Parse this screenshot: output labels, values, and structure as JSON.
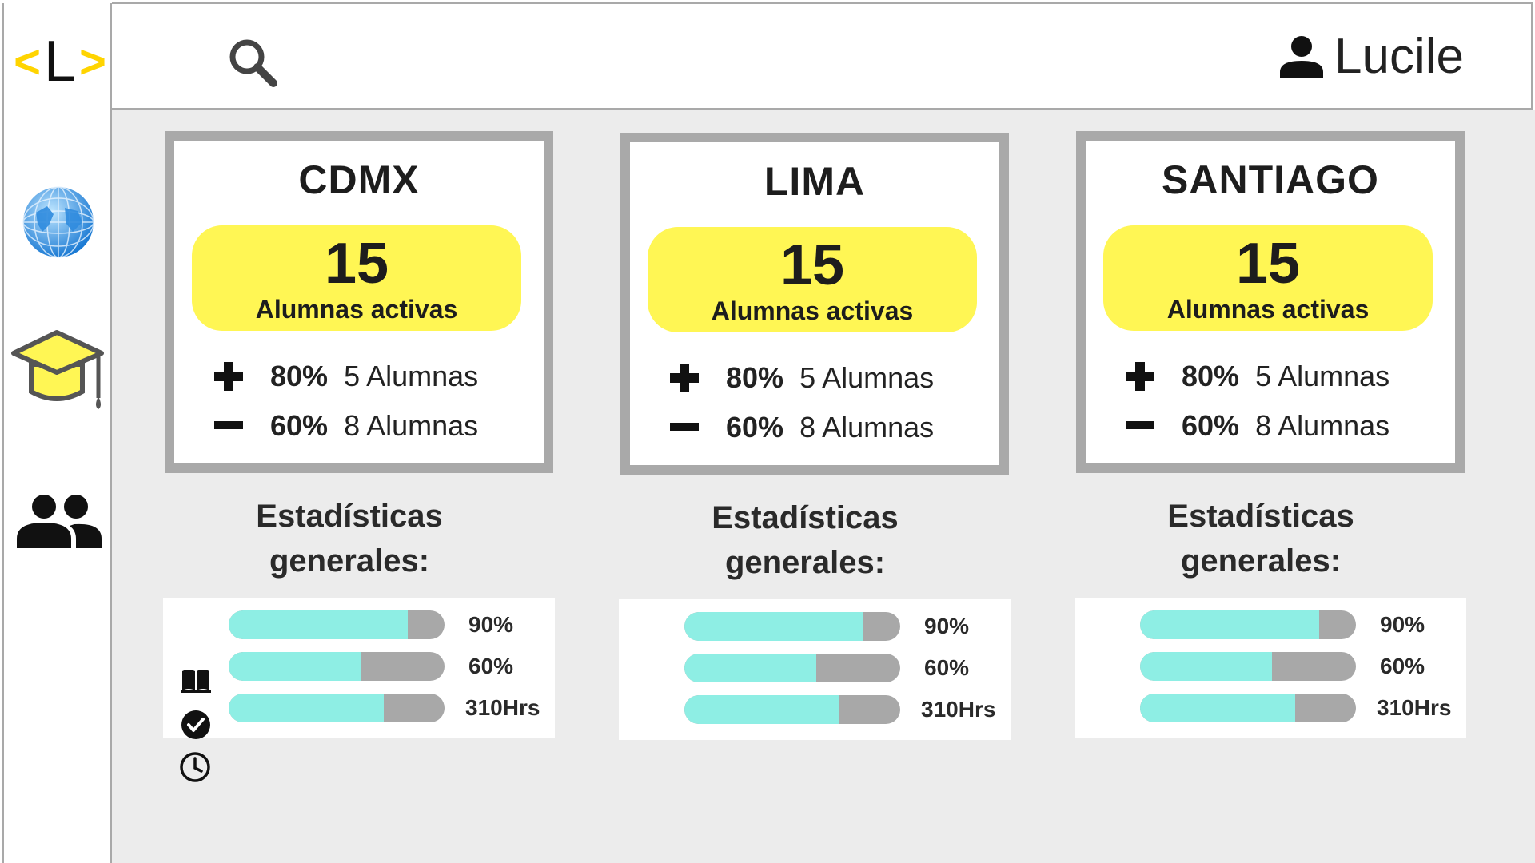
{
  "app": {
    "logo": {
      "left": "<",
      "letter": "L",
      "right": ">"
    },
    "user": {
      "name": "Lucile"
    }
  },
  "sidebar": {
    "items": [
      {
        "icon": "globe-icon"
      },
      {
        "icon": "graduation-cap-icon"
      },
      {
        "icon": "group-icon"
      }
    ]
  },
  "colors": {
    "accent": "#fff654",
    "bar_fill": "#8eeee4",
    "bar_track": "#a8a8a8",
    "border": "#a9a9a9",
    "background": "#ececec"
  },
  "stats_heading_line1": "Estadísticas",
  "stats_heading_line2": "generales:",
  "cities": [
    {
      "name": "CDMX",
      "count": "15",
      "count_label": "Alumnas activas",
      "plus_pct": "80%",
      "plus_text": "5 Alumnas",
      "minus_pct": "60%",
      "minus_text": "8 Alumnas",
      "bars": [
        {
          "label": "90%",
          "fill": 0.83
        },
        {
          "label": "60%",
          "fill": 0.61
        },
        {
          "label": "310Hrs",
          "fill": 0.72
        }
      ]
    },
    {
      "name": "LIMA",
      "count": "15",
      "count_label": "Alumnas activas",
      "plus_pct": "80%",
      "plus_text": "5 Alumnas",
      "minus_pct": "60%",
      "minus_text": "8 Alumnas",
      "bars": [
        {
          "label": "90%",
          "fill": 0.83
        },
        {
          "label": "60%",
          "fill": 0.61
        },
        {
          "label": "310Hrs",
          "fill": 0.72
        }
      ]
    },
    {
      "name": "SANTIAGO",
      "count": "15",
      "count_label": "Alumnas activas",
      "plus_pct": "80%",
      "plus_text": "5 Alumnas",
      "minus_pct": "60%",
      "minus_text": "8 Alumnas",
      "bars": [
        {
          "label": "90%",
          "fill": 0.83
        },
        {
          "label": "60%",
          "fill": 0.61
        },
        {
          "label": "310Hrs",
          "fill": 0.72
        }
      ]
    }
  ],
  "legend_icons": [
    "book-icon",
    "check-circle-icon",
    "clock-icon"
  ]
}
